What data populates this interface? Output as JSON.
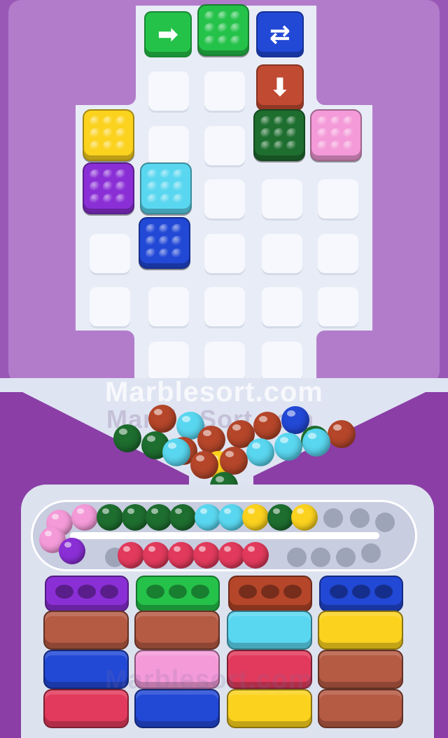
{
  "watermark": {
    "primary": "Marblesort.com",
    "secondary": "Marble Sort.com",
    "bottom": "Marblesort.com"
  },
  "palette": {
    "green": "#25c24a",
    "dark_green": "#1e6e2f",
    "blue": "#2248d6",
    "rust": "#b5462a",
    "yellow": "#fbd21e",
    "pink": "#f49ad8",
    "purple": "#8a2fd6",
    "cyan": "#5ad7f0",
    "red": "#e23a5c",
    "brown": "#b55a43"
  },
  "top_controls": [
    {
      "name": "arrow-right-tile",
      "icon": "arrow-right-icon",
      "glyph": "➡",
      "color": "#25c24a"
    },
    {
      "name": "rotate-tile",
      "icon": "swap-arrows-icon",
      "glyph": "⇄",
      "color": "#2248d6"
    },
    {
      "name": "arrow-down-tile",
      "icon": "arrow-down-icon",
      "glyph": "⬇",
      "color": "#c04a32"
    }
  ],
  "blocks": [
    {
      "name": "block-green-top",
      "color": "#25c24a"
    },
    {
      "name": "block-yellow",
      "color": "#fbd21e"
    },
    {
      "name": "block-dark-green",
      "color": "#1e6e2f"
    },
    {
      "name": "block-pink",
      "color": "#f49ad8"
    },
    {
      "name": "block-purple",
      "color": "#8a2fd6"
    },
    {
      "name": "block-cyan",
      "color": "#5ad7f0"
    },
    {
      "name": "block-blue",
      "color": "#2248d6"
    }
  ],
  "funnel_marbles": [
    "rust",
    "cyan",
    "rust",
    "blue",
    "dark_green",
    "dark_green",
    "rust",
    "rust",
    "rust",
    "cyan",
    "dark_green",
    "rust",
    "cyan",
    "cyan",
    "yellow",
    "cyan",
    "rust",
    "rust",
    "dark_green"
  ],
  "track_top_marbles": [
    "pink",
    "pink",
    "dark_green",
    "dark_green",
    "dark_green",
    "dark_green",
    "cyan",
    "cyan",
    "yellow",
    "dark_green",
    "yellow"
  ],
  "track_bottom_marbles": [
    "pink",
    "purple",
    "red",
    "red",
    "red",
    "red",
    "red",
    "red"
  ],
  "bin_heads": [
    {
      "name": "bin-head-purple",
      "color": "#8a2fd6"
    },
    {
      "name": "bin-head-green",
      "color": "#25c24a"
    },
    {
      "name": "bin-head-rust",
      "color": "#b5462a"
    },
    {
      "name": "bin-head-blue",
      "color": "#2248d6"
    }
  ],
  "bin_columns": [
    [
      "#b55a43",
      "#2248d6",
      "#e23a5c"
    ],
    [
      "#b55a43",
      "#f49ad8",
      "#2248d6"
    ],
    [
      "#5ad7f0",
      "#e23a5c",
      "#fbd21e"
    ],
    [
      "#fbd21e",
      "#b55a43",
      "#b55a43"
    ]
  ]
}
